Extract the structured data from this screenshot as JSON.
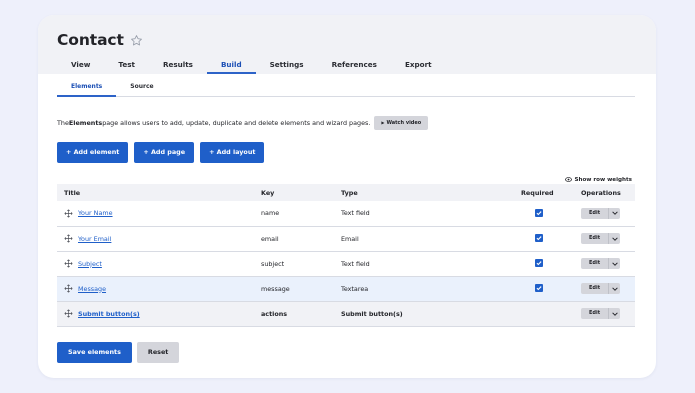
{
  "page": {
    "title": "Contact",
    "star_icon": "star-outline-icon"
  },
  "tabs": [
    {
      "label": "View",
      "active": false
    },
    {
      "label": "Test",
      "active": false
    },
    {
      "label": "Results",
      "active": false
    },
    {
      "label": "Build",
      "active": true
    },
    {
      "label": "Settings",
      "active": false
    },
    {
      "label": "References",
      "active": false
    },
    {
      "label": "Export",
      "active": false
    }
  ],
  "subtabs": [
    {
      "label": "Elements",
      "active": true
    },
    {
      "label": "Source",
      "active": false
    }
  ],
  "description": {
    "prefix": "The ",
    "bold": "Elements",
    "suffix": " page allows users to add, update, duplicate and delete elements and wizard pages.",
    "watch_video_label": "Watch video",
    "watch_video_icon": "play-icon"
  },
  "actions": {
    "add_element": "+ Add element",
    "add_page": "+ Add page",
    "add_layout": "+ Add layout"
  },
  "row_weights_label": "Show row weights",
  "table": {
    "headers": {
      "title": "Title",
      "key": "Key",
      "type": "Type",
      "required": "Required",
      "operations": "Operations"
    },
    "rows": [
      {
        "title": "Your Name",
        "key": "name",
        "type": "Text field",
        "required": true,
        "op": "Edit"
      },
      {
        "title": "Your Email",
        "key": "email",
        "type": "Email",
        "required": true,
        "op": "Edit"
      },
      {
        "title": "Subject",
        "key": "subject",
        "type": "Text field",
        "required": true,
        "op": "Edit"
      },
      {
        "title": "Message",
        "key": "message",
        "type": "Textarea",
        "required": true,
        "op": "Edit"
      },
      {
        "title": "Submit button(s)",
        "key": "actions",
        "type": "Submit button(s)",
        "required": false,
        "op": "Edit"
      }
    ]
  },
  "footer": {
    "save_label": "Save elements",
    "reset_label": "Reset"
  },
  "colors": {
    "accent": "#1f5fc9",
    "background": "#eef0fb",
    "highlight_row": "#eaf1fc"
  }
}
